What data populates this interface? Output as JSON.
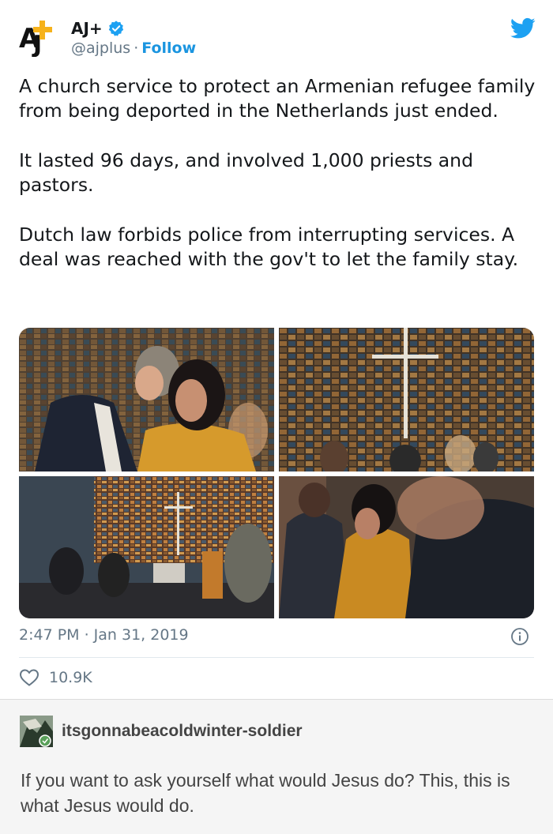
{
  "tweet": {
    "display_name": "AJ+",
    "handle": "@ajplus",
    "separator": "·",
    "follow_label": "Follow",
    "paragraphs": [
      "A church service to protect an Armenian refugee family from being deported in the Netherlands just ended.",
      "It lasted 96 days, and involved 1,000 priests and pastors.",
      "Dutch law forbids police from interrupting services. A deal was reached with the gov't to let the family stay."
    ],
    "timestamp": "2:47 PM · Jan 31, 2019",
    "likes": "10.9K",
    "icons": [
      "aj-logo-icon",
      "verified-badge-icon",
      "twitter-bird-icon",
      "info-icon",
      "heart-icon"
    ],
    "colors": {
      "link": "#1b95e0",
      "muted": "#657786",
      "verified": "#1da1f2",
      "aj_yellow": "#f6b21b"
    }
  },
  "tumblr": {
    "username": "itsgonnabeacoldwinter-soldier",
    "comment": "If you want to ask yourself what would Jesus do? This, this is what Jesus would do."
  }
}
